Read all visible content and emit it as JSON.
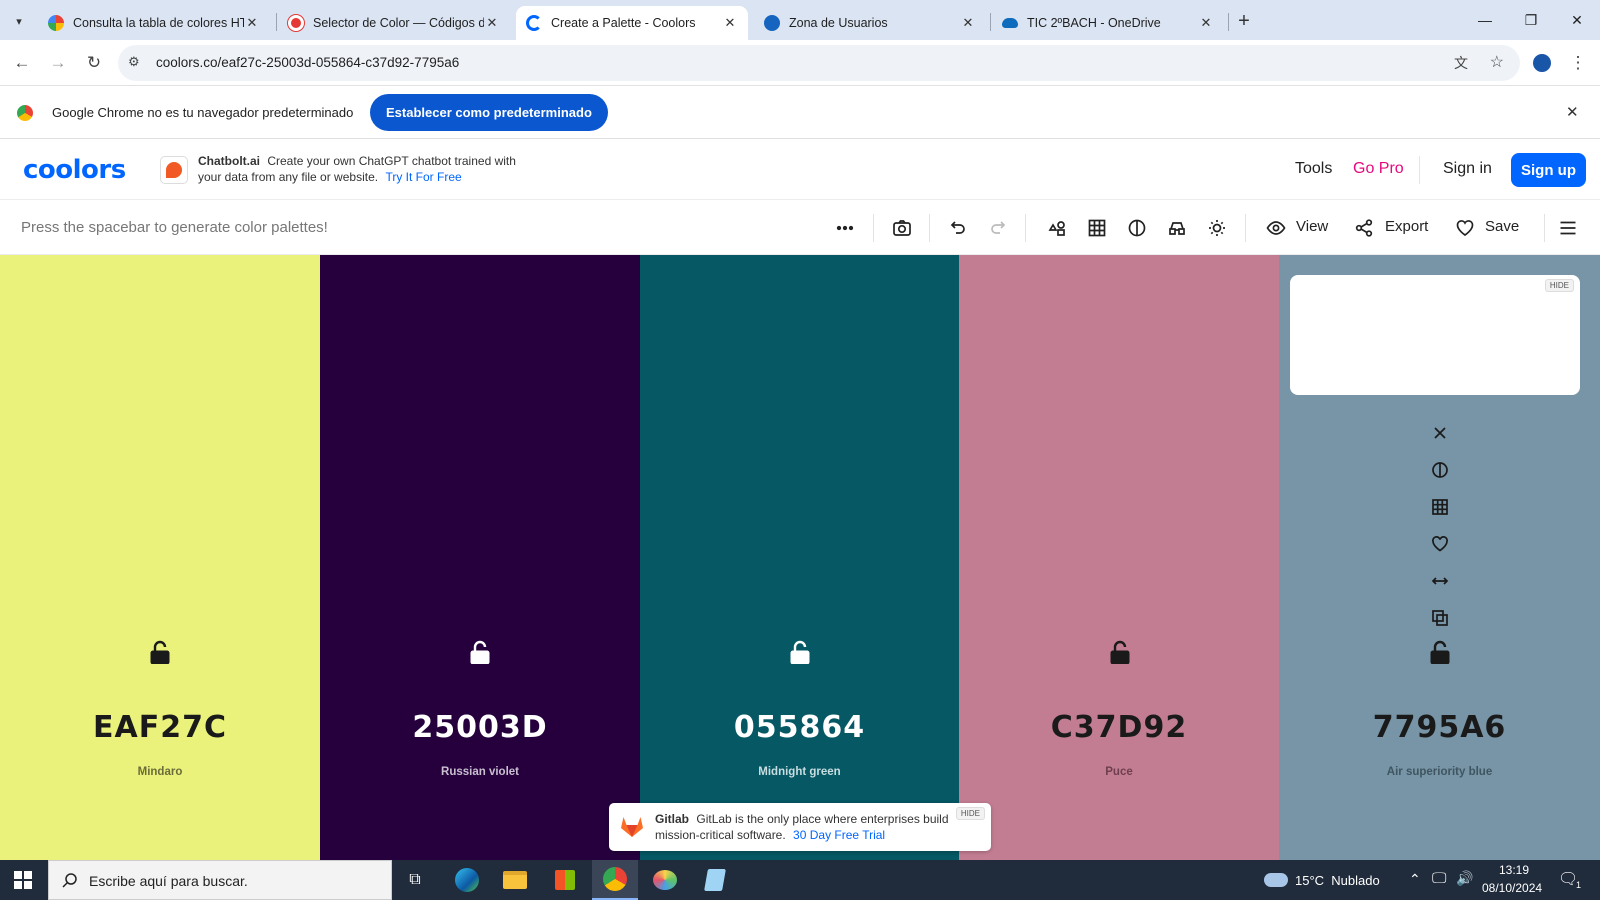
{
  "browser": {
    "tabs": [
      {
        "title": "Consulta la tabla de colores HTML",
        "favicon_color": "#4285f4"
      },
      {
        "title": "Selector de Color — Códigos de color",
        "favicon_color": "#e53935"
      },
      {
        "title": "Create a Palette - Coolors",
        "favicon_color": "#0066ff",
        "active": true
      },
      {
        "title": "Zona de Usuarios",
        "favicon_color": "#1565c0"
      },
      {
        "title": "TIC 2ºBACH - OneDrive",
        "favicon_color": "#0f6cbd"
      }
    ],
    "url": "coolors.co/eaf27c-25003d-055864-c37d92-7795a6"
  },
  "infobar": {
    "message": "Google Chrome no es tu navegador predeterminado",
    "button_label": "Establecer como predeterminado"
  },
  "header": {
    "logo": "coolors",
    "ad": {
      "brand": "Chatbolt.ai",
      "text": "Create your own ChatGPT chatbot trained with your data from any file or website.",
      "cta": "Try It For Free"
    },
    "nav": {
      "tools": "Tools",
      "go_pro": "Go Pro",
      "sign_in": "Sign in",
      "sign_up": "Sign up"
    },
    "go_pro_color": "#e5097f",
    "accent": "#0066ff"
  },
  "toolbar": {
    "hint": "Press the spacebar to generate color palettes!",
    "view_label": "View",
    "export_label": "Export",
    "save_label": "Save"
  },
  "palette": [
    {
      "hex": "EAF27C",
      "name": "Mindaro",
      "color": "#eaf27c",
      "text_color": "#1a1a1a",
      "sub_color": "#6b6d38",
      "locked": false
    },
    {
      "hex": "25003D",
      "name": "Russian violet",
      "color": "#25003d",
      "text_color": "#ffffff",
      "sub_color": "#c9bfd0",
      "locked": false
    },
    {
      "hex": "055864",
      "name": "Midnight green",
      "color": "#055864",
      "text_color": "#ffffff",
      "sub_color": "#c8dde0",
      "locked": false
    },
    {
      "hex": "C37D92",
      "name": "Puce",
      "color": "#c37d92",
      "text_color": "#1a1a1a",
      "sub_color": "#6e3f4e",
      "locked": false
    },
    {
      "hex": "7795A6",
      "name": "Air superiority blue",
      "color": "#7795a6",
      "text_color": "#1a1a1a",
      "sub_color": "#3f5561",
      "locked": false
    }
  ],
  "column_ad": {
    "hide_label": "HIDE"
  },
  "column_icons": [
    "close-icon",
    "contrast-icon",
    "shades-icon",
    "heart-icon",
    "drag-icon",
    "copy-icon"
  ],
  "bottom_ad": {
    "brand": "Gitlab",
    "text": "GitLab is the only place where enterprises build mission-critical software.",
    "cta": "30 Day Free Trial",
    "hide_label": "HIDE"
  },
  "taskbar": {
    "search_placeholder": "Escribe aquí para buscar.",
    "weather": "15°C  Nublado",
    "time": "13:19",
    "date": "08/10/2024",
    "notification_count": "1"
  }
}
